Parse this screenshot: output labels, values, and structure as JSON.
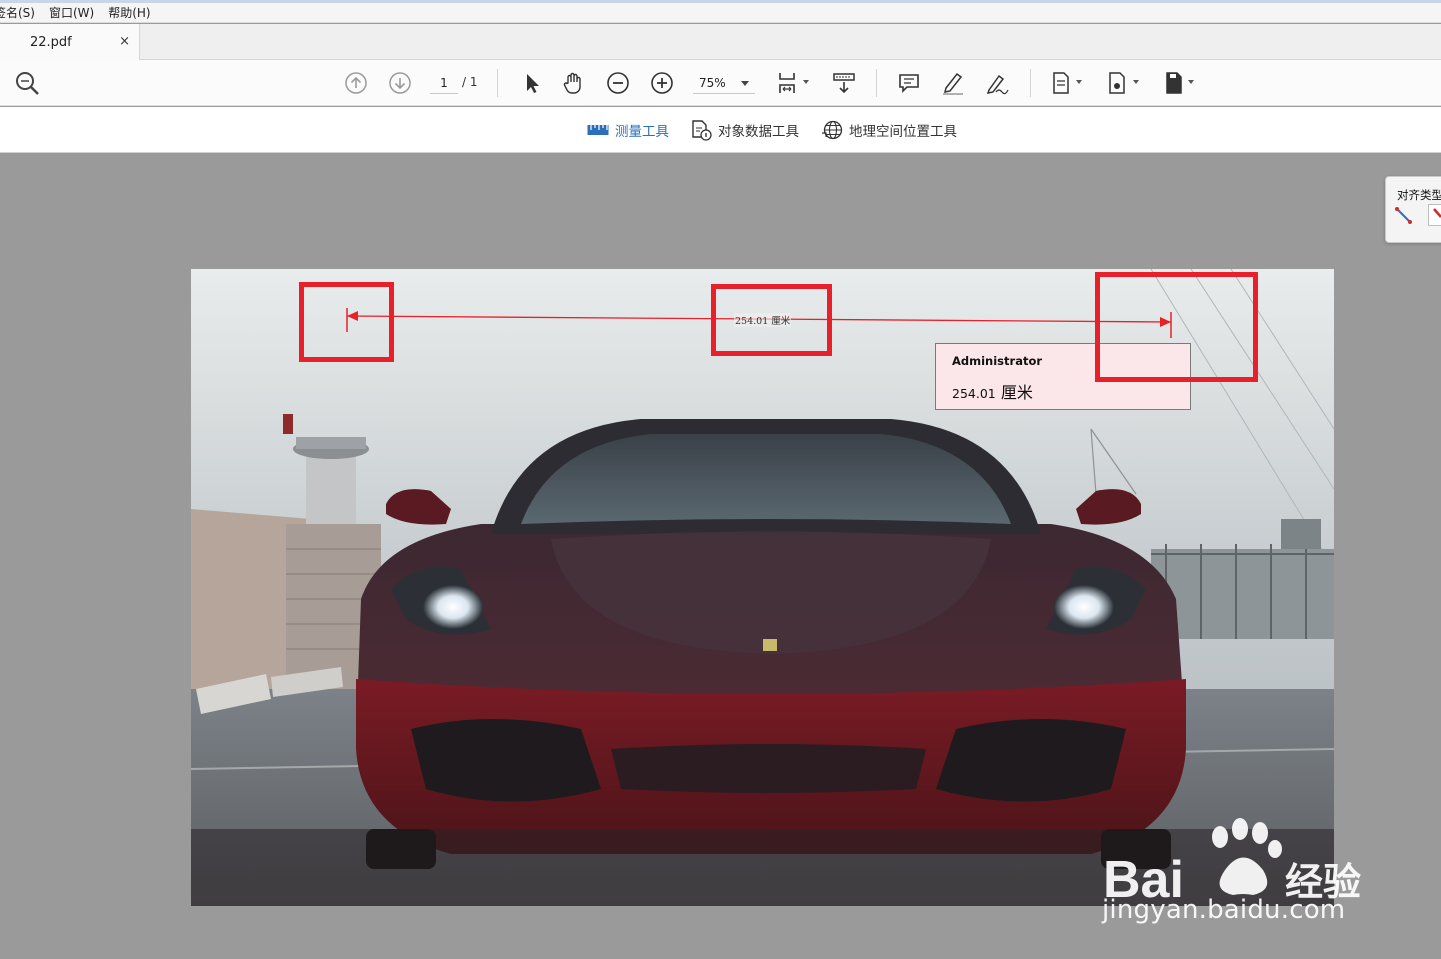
{
  "menubar": {
    "items": [
      "签名(S)",
      "窗口(W)",
      "帮助(H)"
    ]
  },
  "tab": {
    "title": "22.pdf",
    "close": "×"
  },
  "toolbar": {
    "page_current": "1",
    "page_total": "/ 1",
    "zoom": "75%"
  },
  "subtoolbar": {
    "measure": "测量工具",
    "object_data": "对象数据工具",
    "geospatial": "地理空间位置工具"
  },
  "float_panel": {
    "title": "对齐类型"
  },
  "annotation": {
    "line_label": "254.01 厘米",
    "popup_author": "Administrator",
    "popup_value_number": "254.01",
    "popup_value_unit": "厘米"
  },
  "watermark": {
    "brand": "Bai",
    "brand_suffix": "经验",
    "url": "jingyan.baidu.com"
  },
  "colors": {
    "accent": "#2a6fb8",
    "highlight": "#e8202a",
    "measure_line": "#e8202a"
  }
}
